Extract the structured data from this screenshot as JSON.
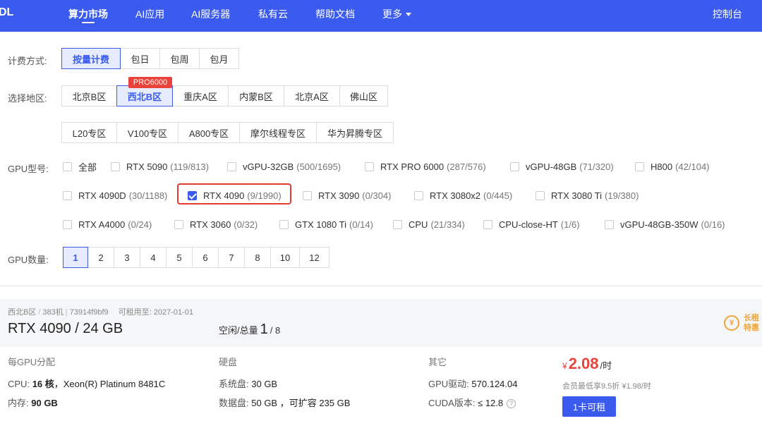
{
  "nav": {
    "logo": "DL",
    "items": [
      "算力市场",
      "AI应用",
      "AI服务器",
      "私有云",
      "帮助文档",
      "更多"
    ],
    "console": "控制台"
  },
  "billing": {
    "label": "计费方式:",
    "options": [
      "按量计费",
      "包日",
      "包周",
      "包月"
    ],
    "selected": "按量计费"
  },
  "region": {
    "label": "选择地区:",
    "row1": [
      "北京B区",
      "西北B区",
      "重庆A区",
      "内蒙B区",
      "北京A区",
      "佛山区"
    ],
    "row2": [
      "L20专区",
      "V100专区",
      "A800专区",
      "摩尔线程专区",
      "华为昇腾专区"
    ],
    "selected": "西北B区",
    "badge": "PRO6000"
  },
  "gpu_model": {
    "label": "GPU型号:",
    "items": [
      {
        "name": "全部",
        "count": ""
      },
      {
        "name": "RTX 5090",
        "count": "(119/813)"
      },
      {
        "name": "vGPU-32GB",
        "count": "(500/1695)"
      },
      {
        "name": "RTX PRO 6000",
        "count": "(287/576)"
      },
      {
        "name": "vGPU-48GB",
        "count": "(71/320)"
      },
      {
        "name": "H800",
        "count": "(42/104)"
      },
      {
        "name": "RTX 4090D",
        "count": "(30/1188)"
      },
      {
        "name": "RTX 4090",
        "count": "(9/1990)"
      },
      {
        "name": "RTX 3090",
        "count": "(0/304)"
      },
      {
        "name": "RTX 3080x2",
        "count": "(0/445)"
      },
      {
        "name": "RTX 3080 Ti",
        "count": "(19/380)"
      },
      {
        "name": "RTX A4000",
        "count": "(0/24)"
      },
      {
        "name": "RTX 3060",
        "count": "(0/32)"
      },
      {
        "name": "GTX 1080 Ti",
        "count": "(0/14)"
      },
      {
        "name": "CPU",
        "count": "(21/334)"
      },
      {
        "name": "CPU-close-HT",
        "count": "(1/6)"
      },
      {
        "name": "vGPU-48GB-350W",
        "count": "(0/16)"
      }
    ],
    "checked": "RTX 4090"
  },
  "gpu_count": {
    "label": "GPU数量:",
    "options": [
      "1",
      "2",
      "3",
      "4",
      "5",
      "6",
      "7",
      "8",
      "10",
      "12"
    ],
    "selected": "1"
  },
  "machine": {
    "region": "西北B区",
    "machine_no": "383机",
    "machine_id": "73914f9bf9",
    "available_until": "可租用至: 2027-01-01",
    "model": "RTX 4090 / 24 GB",
    "idle_label": "空闲/总量",
    "idle": "1",
    "total": "/ 8",
    "long_rent_1": "长租",
    "long_rent_2": "特惠",
    "long_rent_icon": "¥",
    "per_gpu_title": "每GPU分配",
    "cpu_label": "CPU:",
    "cpu_cores": "16 核",
    "cpu_model": "，Xeon(R) Platinum 8481C",
    "mem_label": "内存:",
    "mem_value": "90 GB",
    "disk_title": "硬盘",
    "sys_disk_label": "系统盘:",
    "sys_disk_value": "30 GB",
    "data_disk_label": "数据盘:",
    "data_disk_value": "50 GB ，可扩容 235 GB",
    "other_title": "其它",
    "driver_label": "GPU驱动:",
    "driver_value": "570.124.04",
    "cuda_label": "CUDA版本:",
    "cuda_value": "≤ 12.8",
    "help_icon": "?",
    "price_yen": "¥",
    "price": "2.08",
    "price_unit": "/时",
    "member_price": "会员最低享9.5折 ¥1.98/时",
    "rent_button": "1卡可租"
  },
  "colors": {
    "primary": "#3b5bef",
    "danger": "#e9423a",
    "promo": "#f0a43a"
  }
}
